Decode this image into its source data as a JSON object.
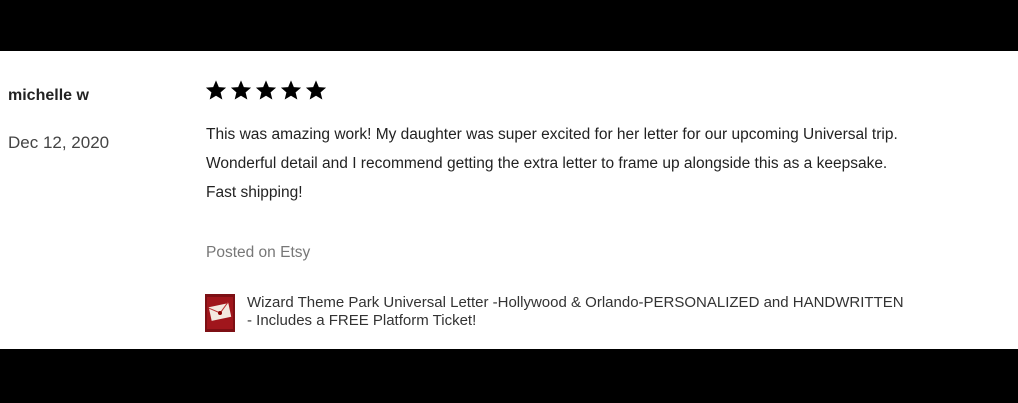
{
  "review": {
    "reviewer_name": "michelle w",
    "date": "Dec 12, 2020",
    "rating": 5,
    "rating_max": 5,
    "text_lines": [
      "This was amazing work! My daughter was super excited for her letter for our upcoming Universal trip.",
      "Wonderful detail and I recommend getting the extra letter to frame up alongside this as a keepsake.",
      "Fast shipping!"
    ],
    "source_label": "Posted on Etsy",
    "product_title": "Wizard Theme Park Universal Letter -Hollywood & Orlando-PERSONALIZED and HANDWRITTEN - Includes a FREE Platform Ticket!",
    "product_thumb_icon": "letter-thumbnail-icon"
  },
  "colors": {
    "frame": "#000000",
    "card_background": "#ffffff",
    "text": "#222222",
    "muted_text": "#777777",
    "thumbnail_accent": "#a0161c"
  }
}
